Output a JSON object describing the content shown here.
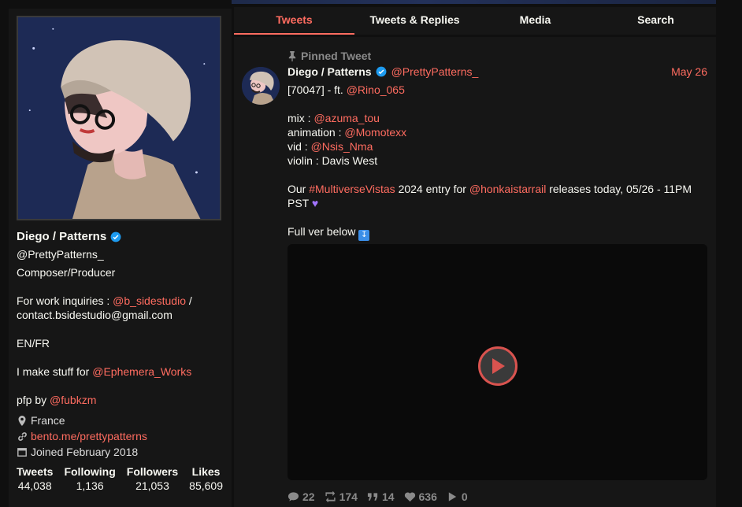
{
  "profile": {
    "name": "Diego / Patterns",
    "handle": "@PrettyPatterns_",
    "bio": {
      "line1": "Composer/Producer",
      "work_prefix": "For work inquiries : ",
      "work_link": "@b_sidestudio",
      "work_sep": " /",
      "email": "contact.bsidestudio@gmail.com",
      "langs": "EN/FR",
      "make_prefix": "I make stuff for ",
      "make_link": "@Ephemera_Works",
      "pfp_prefix": "pfp by ",
      "pfp_link": "@fubkzm"
    },
    "location": "France",
    "website": "bento.me/prettypatterns",
    "joined": "Joined February 2018",
    "stats": [
      {
        "label": "Tweets",
        "value": "44,038"
      },
      {
        "label": "Following",
        "value": "1,136"
      },
      {
        "label": "Followers",
        "value": "21,053"
      },
      {
        "label": "Likes",
        "value": "85,609"
      }
    ]
  },
  "tabs": [
    {
      "label": "Tweets",
      "active": true
    },
    {
      "label": "Tweets & Replies",
      "active": false
    },
    {
      "label": "Media",
      "active": false
    },
    {
      "label": "Search",
      "active": false
    }
  ],
  "tweet": {
    "pinned_label": "Pinned Tweet",
    "name": "Diego / Patterns",
    "handle": "@PrettyPatterns_",
    "date": "May 26",
    "line1_prefix": "[70047] - ft. ",
    "line1_link": "@Rino_065",
    "credits": [
      {
        "role": "mix : ",
        "link": "@azuma_tou"
      },
      {
        "role": "animation : ",
        "link": "@Momotexx"
      },
      {
        "role": "vid : ",
        "link": "@Nsis_Nma"
      }
    ],
    "violin": "violin : Davis West",
    "our_prefix": "Our ",
    "hashtag": "#MultiverseVistas",
    "mid": " 2024 entry for ",
    "game_link": "@honkaistarrail",
    "release": " releases today, 05/26 - 11PM PST ",
    "full_ver": "Full ver below ",
    "stats": {
      "replies": "22",
      "retweets": "174",
      "quotes": "14",
      "likes": "636",
      "plays": "0"
    }
  },
  "colors": {
    "accent": "#ff6c60",
    "background": "#0f0f0f",
    "panel": "#161616",
    "muted": "#8a8a8a",
    "verified": "#1d9bf0"
  }
}
